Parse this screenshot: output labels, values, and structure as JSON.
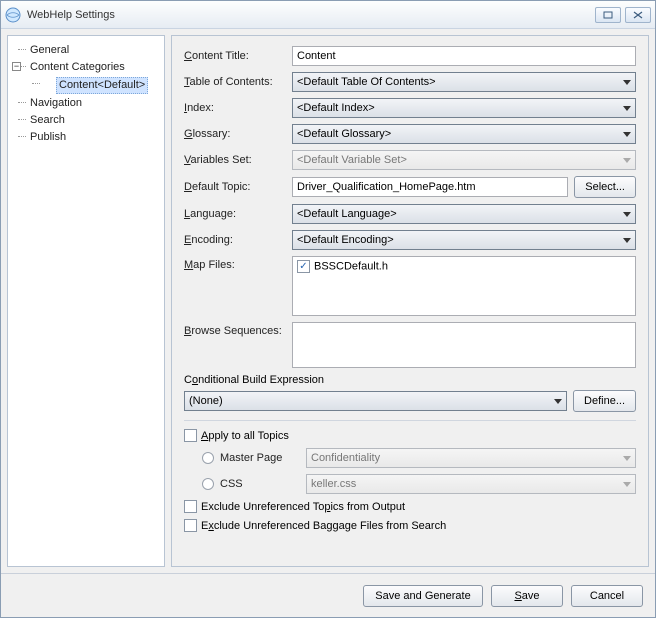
{
  "window": {
    "title": "WebHelp Settings"
  },
  "tree": {
    "items": [
      {
        "label": "General"
      },
      {
        "label": "Content Categories",
        "expanded": true,
        "children": [
          {
            "label": "Content<Default>",
            "selected": true
          }
        ]
      },
      {
        "label": "Navigation"
      },
      {
        "label": "Search"
      },
      {
        "label": "Publish"
      }
    ]
  },
  "form": {
    "content_title": {
      "label": "Content Title:",
      "value": "Content"
    },
    "toc": {
      "label": "Table of Contents:",
      "value": "<Default Table Of Contents>"
    },
    "index": {
      "label": "Index:",
      "value": "<Default Index>"
    },
    "glossary": {
      "label": "Glossary:",
      "value": "<Default Glossary>"
    },
    "variables": {
      "label": "Variables Set:",
      "value": "<Default Variable Set>",
      "disabled": true
    },
    "default_topic": {
      "label": "Default Topic:",
      "value": "Driver_Qualification_HomePage.htm",
      "select_btn": "Select..."
    },
    "language": {
      "label": "Language:",
      "value": "<Default Language>"
    },
    "encoding": {
      "label": "Encoding:",
      "value": "<Default Encoding>"
    },
    "map_files": {
      "label": "Map Files:",
      "items": [
        {
          "label": "BSSCDefault.h",
          "checked": true
        }
      ]
    },
    "browse_seq": {
      "label": "Browse Sequences:"
    },
    "cond_build": {
      "label": "Conditional Build Expression",
      "value": "(None)",
      "define_btn": "Define..."
    },
    "apply_all": {
      "label": "Apply to all Topics",
      "checked": false
    },
    "master_page": {
      "label": "Master Page",
      "value": "Confidentiality",
      "disabled": true
    },
    "css": {
      "label": "CSS",
      "value": "keller.css",
      "disabled": true
    },
    "exclude_topics": {
      "label": "Exclude Unreferenced Topics from Output",
      "checked": false
    },
    "exclude_baggage": {
      "label": "Exclude Unreferenced Baggage Files from Search",
      "checked": false
    }
  },
  "footer": {
    "save_generate": "Save and Generate",
    "save": "Save",
    "cancel": "Cancel"
  }
}
